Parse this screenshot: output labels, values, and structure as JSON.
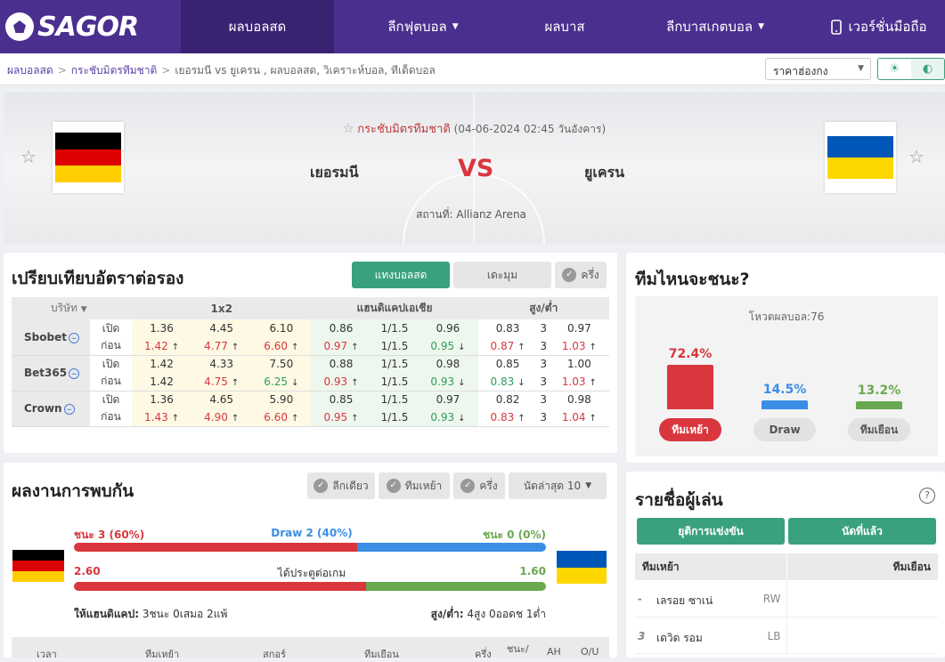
{
  "nav": {
    "logo": "SAGOR",
    "items": [
      {
        "label": "ผลบอลสด",
        "active": true,
        "caret": false
      },
      {
        "label": "ลีกฟุตบอล",
        "active": false,
        "caret": true
      },
      {
        "label": "ผลบาส",
        "active": false,
        "caret": false
      },
      {
        "label": "ลีกบาสเกตบอล",
        "active": false,
        "caret": true
      },
      {
        "label": "เวอร์ชั่นมือถือ",
        "active": false,
        "caret": false
      }
    ]
  },
  "breadcrumb": {
    "home": "ผลบอลสด",
    "league": "กระชับมิตรทีมชาติ",
    "current": "เยอรมนี vs  ยูเครน ,  ผลบอลสด,  วิเคราะห์บอล,  ทีเด็ดบอล"
  },
  "odds_select": {
    "value": "ราคาฮ่องกง"
  },
  "match": {
    "league": "กระชับมิตรทีมชาติ",
    "datetime": "(04-06-2024 02:45 วันอังคาร)",
    "home": "เยอรมนี",
    "away": "ยูเครน",
    "vs": "VS",
    "venue": "สถานที่: Allianz Arena"
  },
  "colors": {
    "purple": "#4b2f8f",
    "green": "#3aa17e",
    "red": "#d9363e",
    "blue": "#3a8ee6",
    "olive": "#6aa84f"
  },
  "odds": {
    "title": "เปรียบเทียบอัตราต่อรอง",
    "tabs": [
      "แทงบอลสด",
      "เดะมุม",
      "ครึ่ง"
    ],
    "headers": {
      "company": "บริษัท",
      "x12": "1x2",
      "ah": "แฮนดิแคปเอเชีย",
      "ou": "สูง/ต่ำ"
    },
    "label_open": "เปิด",
    "label_before": "ก่อน",
    "rows": [
      {
        "book": "Sbobet",
        "open": [
          "1.36",
          "4.45",
          "6.10",
          "0.86",
          "1/1.5",
          "0.96",
          "0.83",
          "3",
          "0.97"
        ],
        "before": [
          "1.42",
          "4.77",
          "6.60",
          "0.97",
          "1/1.5",
          "0.95",
          "0.87",
          "3",
          "1.03"
        ],
        "dir": [
          "up",
          "up",
          "up",
          "up",
          "",
          "dn",
          "up",
          "",
          "up"
        ]
      },
      {
        "book": "Bet365",
        "open": [
          "1.42",
          "4.33",
          "7.50",
          "0.88",
          "1/1.5",
          "0.98",
          "0.85",
          "3",
          "1.00"
        ],
        "before": [
          "1.42",
          "4.75",
          "6.25",
          "0.93",
          "1/1.5",
          "0.93",
          "0.83",
          "3",
          "1.03"
        ],
        "dir": [
          "",
          "up",
          "dn",
          "up",
          "",
          "dn",
          "dn",
          "",
          "up"
        ]
      },
      {
        "book": "Crown",
        "open": [
          "1.36",
          "4.65",
          "5.90",
          "0.85",
          "1/1.5",
          "0.97",
          "0.82",
          "3",
          "0.98"
        ],
        "before": [
          "1.43",
          "4.90",
          "6.60",
          "0.95",
          "1/1.5",
          "0.93",
          "0.83",
          "3",
          "1.04"
        ],
        "dir": [
          "up",
          "up",
          "up",
          "up",
          "",
          "dn",
          "up",
          "",
          "up"
        ]
      }
    ]
  },
  "vote": {
    "title": "ทีมไหนจะชนะ?",
    "total": "โหวตผลบอล:76",
    "home": {
      "pct": "72.4%",
      "value": 72.4,
      "label": "ทีมเหย้า"
    },
    "draw": {
      "pct": "14.5%",
      "value": 14.5,
      "label": "Draw"
    },
    "away": {
      "pct": "13.2%",
      "value": 13.2,
      "label": "ทีมเยือน"
    }
  },
  "h2h": {
    "title": "ผลงานการพบกัน",
    "filters": [
      "ลีกเดียว",
      "ทีมเหย้า",
      "ครึ่ง"
    ],
    "recent": "นัดล่าสุด 10",
    "win": "ชนะ 3 (60%)",
    "draw": "Draw 2 (40%)",
    "loss": "ชนะ 0 (0%)",
    "win_share": 60,
    "draw_share": 40,
    "goals_home": "2.60",
    "goals_label": "ได้ประตูต่อเกม",
    "goals_away": "1.60",
    "goals_home_value": 2.6,
    "goals_away_value": 1.6,
    "handicap": "ให้แฮนดิแคป:",
    "handicap_val": "3ชนะ 0เสมอ 2แพ้",
    "ou": "สูง/ต่ำ:",
    "ou_val": "4สูง 0ออดช 1ต่ำ",
    "cols": [
      "เวลา",
      "ทีมเหย้า",
      "สกอร์",
      "ทีมเยือน",
      "ครึ่ง",
      "ชนะ/",
      "AH",
      "O/U"
    ]
  },
  "players": {
    "title": "รายชื่อผู้เล่น",
    "help": "?",
    "tabs": [
      "ยุติการแข่งขัน",
      "นัดที่แล้ว"
    ],
    "home": "ทีมเหย้า",
    "away": "ทีมเยือน",
    "rows": [
      {
        "no": "-",
        "name": "เลรอย ซาเน่",
        "pos": "RW"
      },
      {
        "no": "3",
        "name": "เดวิด รอม",
        "pos": "LB"
      }
    ]
  }
}
